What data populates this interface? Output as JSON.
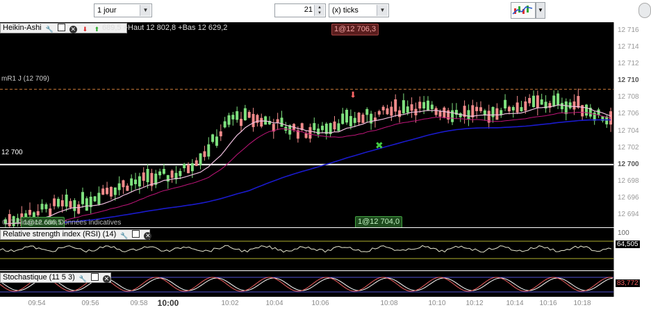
{
  "toolbar": {
    "period_select": "1 jour",
    "ticks_value": "21",
    "unit_select": "(x) ticks",
    "chart_type_icon": "chart-style-icon",
    "dropdown_icon": "chevron-down-icon"
  },
  "main_panel": {
    "indicator_name": "Heikin-Ashi",
    "header_values": "689,5 +Haut 12 802,8 +Bas 12 629,2",
    "top_tag": "1@12 706,3",
    "bottom_tag": "1@12 704,0",
    "left_tag": "1@12 686,5",
    "mr1_label": "mR1 J (12 709)",
    "level_label": "12 700",
    "watermark": "© IT-Finance.com Données indicatives",
    "y_ticks": [
      "12 716",
      "12 714",
      "12 712",
      "12 710",
      "12 708",
      "12 706",
      "12 704",
      "12 702",
      "12 700",
      "12 698",
      "12 696",
      "12 694"
    ],
    "colors": {
      "bull": "#7ee07e",
      "bear": "#f08a8a",
      "ma_blue": "#1a1acc",
      "ma_pink": "#f0c0e0",
      "ma_magenta": "#c0157a",
      "mr1": "#c87a3a"
    }
  },
  "rsi_panel": {
    "title": "Relative strength index (RSI) (14)",
    "value": "64,505",
    "top_tick": "100"
  },
  "stoch_panel": {
    "title": "Stochastique (11 5 3)",
    "value": "83,772"
  },
  "x_axis": {
    "labels": [
      "09:54",
      "09:56",
      "09:58",
      "10:00",
      "10:02",
      "10:04",
      "10:06",
      "10:08",
      "10:10",
      "10:12",
      "10:14",
      "10:16",
      "10:18"
    ]
  },
  "chart_data": {
    "type": "candlestick",
    "title": "Heikin-Ashi",
    "xlabel": "",
    "ylabel": "",
    "ylim": [
      12692.5,
      12717
    ],
    "x": [
      "09:54",
      "09:56",
      "09:58",
      "10:00",
      "10:02",
      "10:04",
      "10:06",
      "10:08",
      "10:10",
      "10:12",
      "10:14",
      "10:16",
      "10:18"
    ],
    "series": [
      {
        "close": [
          12693.2,
          12694.1,
          12695.0,
          12695.3,
          12697.0,
          12697.8,
          12698.4,
          12699.1,
          12701.8,
          12705.6,
          12705.4,
          12704.6,
          12703.8,
          12704.9,
          12705.5,
          12706.1,
          12707.0,
          12706.5,
          12706.2,
          12706.0,
          12706.9,
          12707.2,
          12707.4,
          12706.8,
          12705.3
        ]
      }
    ]
  }
}
